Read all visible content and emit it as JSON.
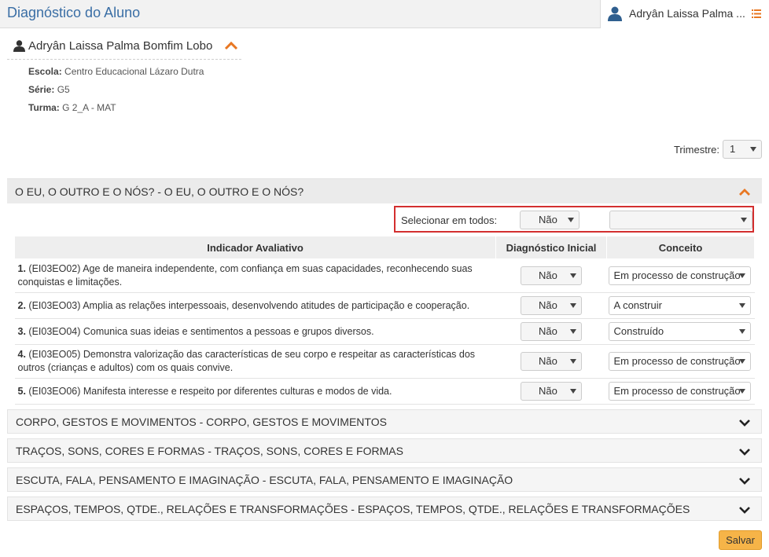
{
  "header": {
    "title": "Diagnóstico do Aluno",
    "user_name": "Adryân Laissa Palma ..."
  },
  "student": {
    "name": "Adryân Laissa Palma Bomfim Lobo",
    "escola_label": "Escola:",
    "escola": "Centro Educacional Lázaro Dutra",
    "serie_label": "Série:",
    "serie": "G5",
    "turma_label": "Turma:",
    "turma": "G 2_A - MAT"
  },
  "trimestre": {
    "label": "Trimestre:",
    "value": "1"
  },
  "open_section": {
    "title": "O EU, O OUTRO E O NÓS? - O EU, O OUTRO E O NÓS?",
    "select_all": {
      "label": "Selecionar em todos:",
      "diag_value": "Não",
      "conceito_value": ""
    },
    "columns": [
      "Indicador Avaliativo",
      "Diagnóstico Inicial",
      "Conceito"
    ],
    "rows": [
      {
        "num": "1.",
        "text": "(EI03EO02) Age de maneira independente, com confiança em suas capacidades, reconhecendo suas conquistas e limitações.",
        "diag": "Não",
        "conceito": "Em processo de construção"
      },
      {
        "num": "2.",
        "text": "(EI03EO03) Amplia as relações interpessoais, desenvolvendo atitudes de participação e cooperação.",
        "diag": "Não",
        "conceito": "A construir"
      },
      {
        "num": "3.",
        "text": "(EI03EO04) Comunica suas ideias e sentimentos a pessoas e grupos diversos.",
        "diag": "Não",
        "conceito": "Construído"
      },
      {
        "num": "4.",
        "text": "(EI03EO05) Demonstra valorização das características de seu corpo e respeitar as características dos outros (crianças e adultos) com os quais convive.",
        "diag": "Não",
        "conceito": "Em processo de construção"
      },
      {
        "num": "5.",
        "text": "(EI03EO06) Manifesta interesse e respeito por diferentes culturas e modos de vida.",
        "diag": "Não",
        "conceito": "Em processo de construção"
      }
    ]
  },
  "collapsed_sections": [
    "CORPO, GESTOS E MOVIMENTOS - CORPO, GESTOS E MOVIMENTOS",
    "TRAÇOS, SONS, CORES E FORMAS - TRAÇOS, SONS, CORES E FORMAS",
    "ESCUTA, FALA, PENSAMENTO E IMAGINAÇÃO - ESCUTA, FALA, PENSAMENTO E IMAGINAÇÃO",
    "ESPAÇOS, TEMPOS, QTDE., RELAÇÕES E TRANSFORMAÇÕES - ESPAÇOS, TEMPOS, QTDE., RELAÇÕES E TRANSFORMAÇÕES"
  ],
  "save_label": "Salvar",
  "colors": {
    "title_blue": "#3a6ea5",
    "accent_orange": "#e87722",
    "highlight_red": "#d32f2f",
    "save_button": "#f6b448"
  }
}
